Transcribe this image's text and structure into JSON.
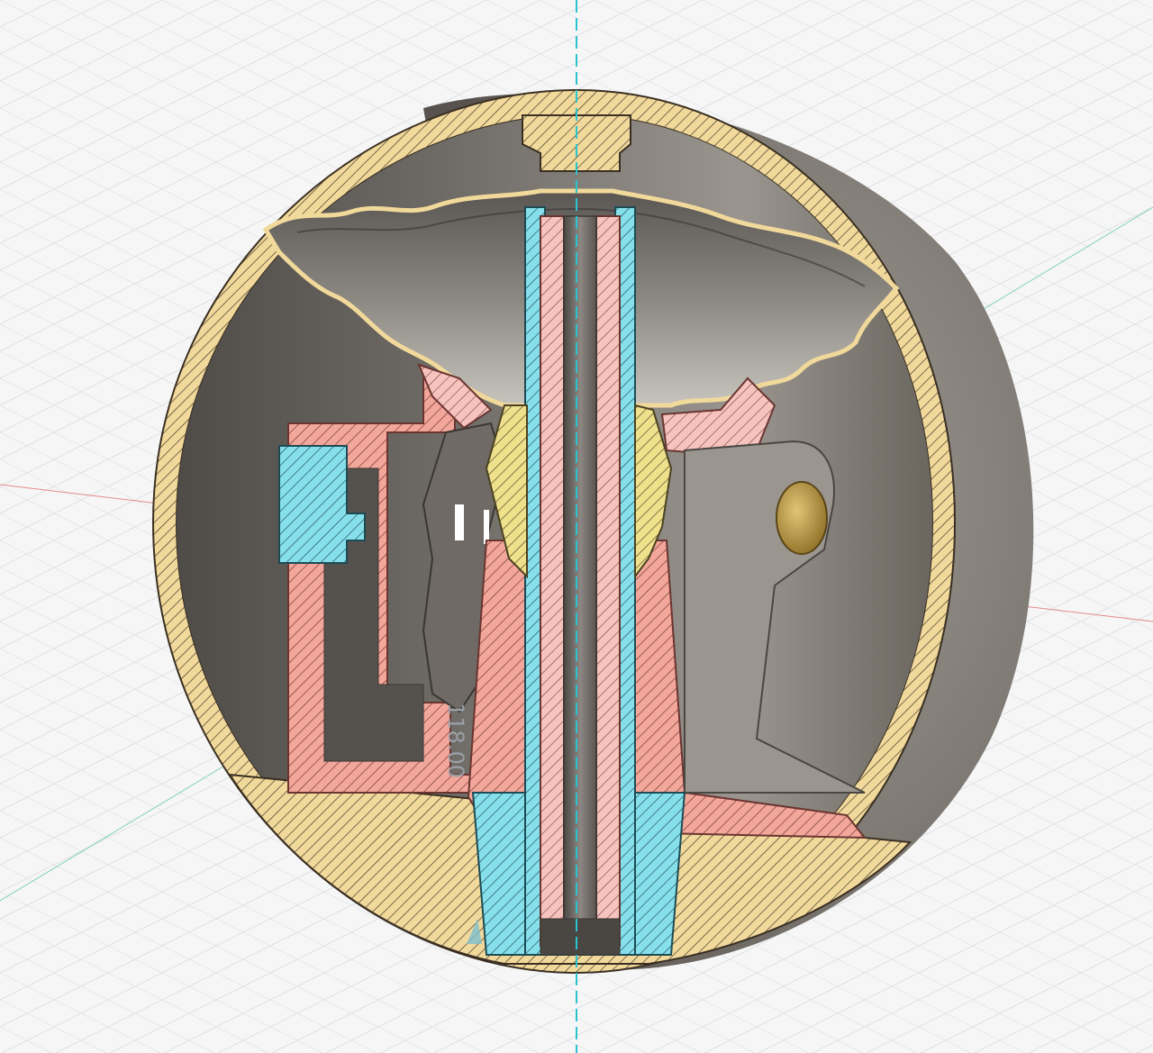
{
  "viewport": {
    "dimension_label": "118.00",
    "colors": {
      "background": "#f6f6f6",
      "grid": "#d9dde3",
      "axis_vertical": "#29c4cf",
      "axis_red": "#e58a8a",
      "axis_green": "#7fd3b5",
      "shell_section": "#f1d99b",
      "hatch": "#3a2f22",
      "salmon_section": "#f3a69a",
      "pink_section": "#f6c3bf",
      "cyan_section": "#86e0eb",
      "yellow_section": "#efe08c",
      "metal_dark": "#5f5a55",
      "metal_mid": "#8a857f",
      "metal_light": "#bdb8b2",
      "brass": "#b3923a"
    },
    "icons": [
      "section-hatch-icon",
      "view-cube-triangle-icon"
    ]
  }
}
